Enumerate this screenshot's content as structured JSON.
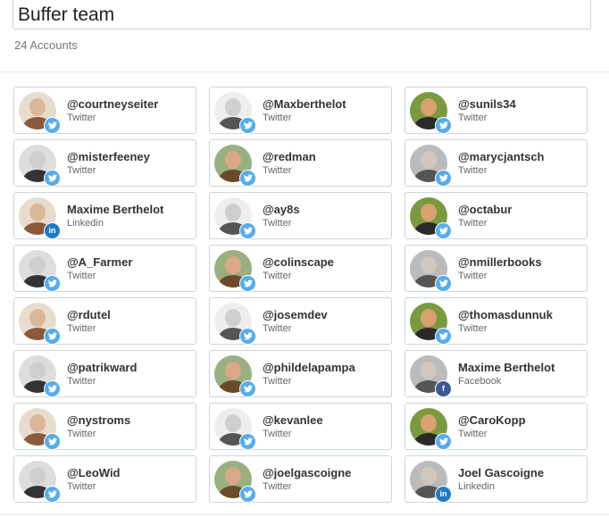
{
  "group": {
    "title": "Buffer team",
    "count_label": "24 Accounts"
  },
  "colors": {
    "twitter": "#55acee",
    "linkedin": "#1f7bc1",
    "facebook": "#3b5998"
  },
  "accounts": [
    {
      "name": "@courtneyseiter",
      "service": "Twitter",
      "icon": "twitter-icon"
    },
    {
      "name": "@Maxberthelot",
      "service": "Twitter",
      "icon": "twitter-icon"
    },
    {
      "name": "@sunils34",
      "service": "Twitter",
      "icon": "twitter-icon"
    },
    {
      "name": "@misterfeeney",
      "service": "Twitter",
      "icon": "twitter-icon"
    },
    {
      "name": "@redman",
      "service": "Twitter",
      "icon": "twitter-icon"
    },
    {
      "name": "@marycjantsch",
      "service": "Twitter",
      "icon": "twitter-icon"
    },
    {
      "name": "Maxime Berthelot",
      "service": "Linkedin",
      "icon": "linkedin-icon"
    },
    {
      "name": "@ay8s",
      "service": "Twitter",
      "icon": "twitter-icon"
    },
    {
      "name": "@octabur",
      "service": "Twitter",
      "icon": "twitter-icon"
    },
    {
      "name": "@A_Farmer",
      "service": "Twitter",
      "icon": "twitter-icon"
    },
    {
      "name": "@colinscape",
      "service": "Twitter",
      "icon": "twitter-icon"
    },
    {
      "name": "@nmillerbooks",
      "service": "Twitter",
      "icon": "twitter-icon"
    },
    {
      "name": "@rdutel",
      "service": "Twitter",
      "icon": "twitter-icon"
    },
    {
      "name": "@josemdev",
      "service": "Twitter",
      "icon": "twitter-icon"
    },
    {
      "name": "@thomasdunnuk",
      "service": "Twitter",
      "icon": "twitter-icon"
    },
    {
      "name": "@patrikward",
      "service": "Twitter",
      "icon": "twitter-icon"
    },
    {
      "name": "@phildelapampa",
      "service": "Twitter",
      "icon": "twitter-icon"
    },
    {
      "name": "Maxime Berthelot",
      "service": "Facebook",
      "icon": "facebook-icon"
    },
    {
      "name": "@nystroms",
      "service": "Twitter",
      "icon": "twitter-icon"
    },
    {
      "name": "@kevanlee",
      "service": "Twitter",
      "icon": "twitter-icon"
    },
    {
      "name": "@CaroKopp",
      "service": "Twitter",
      "icon": "twitter-icon"
    },
    {
      "name": "@LeoWid",
      "service": "Twitter",
      "icon": "twitter-icon"
    },
    {
      "name": "@joelgascoigne",
      "service": "Twitter",
      "icon": "twitter-icon"
    },
    {
      "name": "Joel Gascoigne",
      "service": "Linkedin",
      "icon": "linkedin-icon"
    }
  ]
}
